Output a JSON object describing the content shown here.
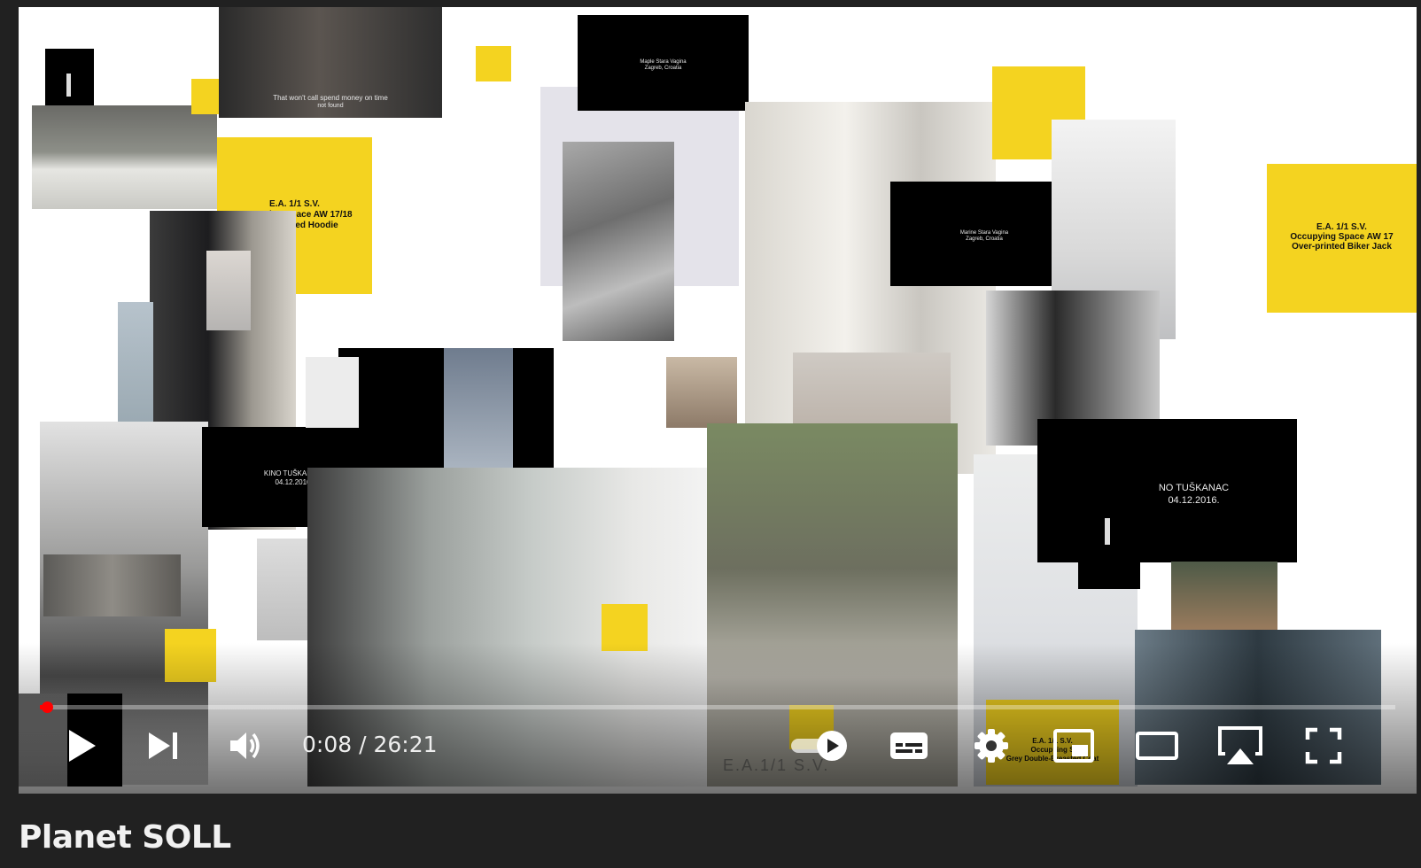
{
  "video": {
    "title": "Planet SOLL",
    "time_current": "0:08",
    "time_separator": " / ",
    "time_total": "26:21",
    "progress_fraction": 0.0051
  },
  "frame": {
    "card_1": {
      "line1": "E.A. 1/1 S.V.",
      "line2": "Occupying Space AW 17/18",
      "line3": "Embroidered Hoodie"
    },
    "card_2": {
      "line1": "E.A. 1/1 S.V.",
      "line2": "Occupying Space AW 17",
      "line3": "Over-printed Biker Jack"
    },
    "card_3": {
      "line1": "E.A. 1/1 S.V.",
      "line2": "Occupying S",
      "line3": "Grey Double-Breasted Coat"
    },
    "kino_1": {
      "line1": "KINO TUŠKANAC",
      "line2": "04.12.2016"
    },
    "kino_2": {
      "line1": "NO TUŠKANAC",
      "line2": "04.12.2016."
    },
    "subtitle_line": "That won't call spend money on time",
    "subtitle_line2": "not found",
    "location_1": "Maple Stara Vagina Zagreb, Croatia",
    "location_2": "Marine Stara Vagina Zagreb, Croatia",
    "watermark": "E.A.1/1 S.V."
  },
  "colors": {
    "accent": "#ff0000",
    "card_yellow": "#f4d320",
    "page_bg": "#212121"
  },
  "icons": {
    "play": "play-icon",
    "next": "next-icon",
    "volume": "volume-icon",
    "autoplay": "autoplay-toggle-icon",
    "captions": "captions-icon",
    "settings": "gear-icon",
    "miniplayer": "miniplayer-icon",
    "theater": "theater-mode-icon",
    "airplay": "airplay-icon",
    "fullscreen": "fullscreen-icon"
  }
}
